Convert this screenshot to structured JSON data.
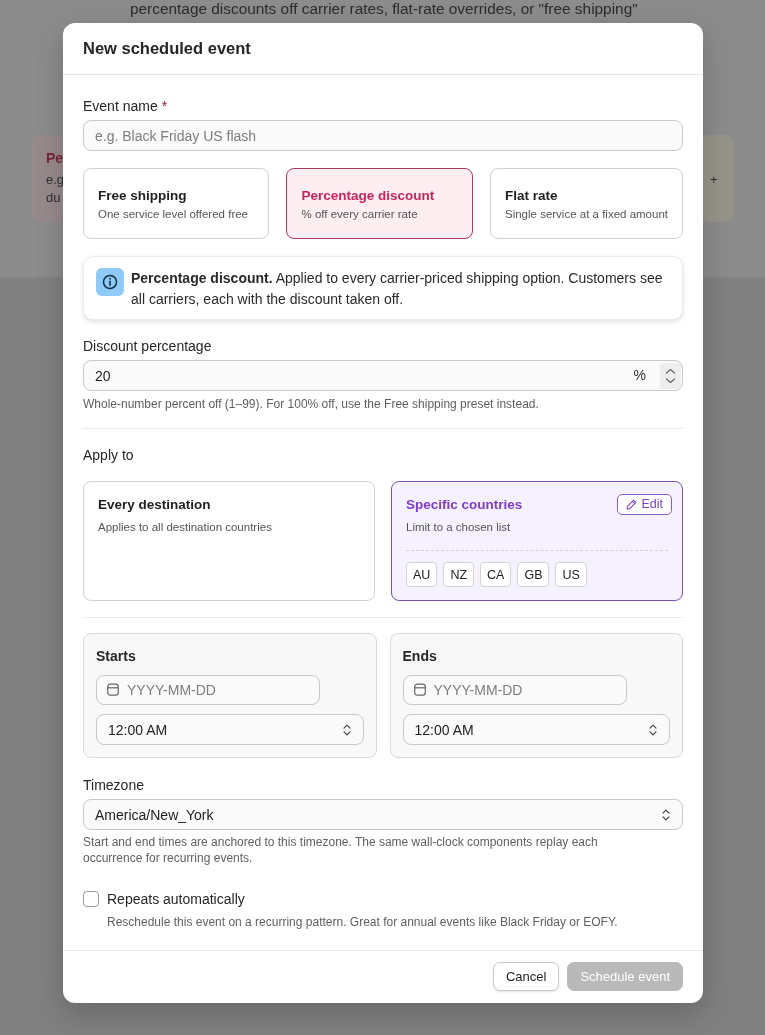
{
  "background": {
    "intro": "percentage discounts off carrier rates, flat-rate overrides, or \"free shipping\"",
    "cards": [
      {
        "title": "Pe",
        "lines": [
          "e.g",
          "du"
        ],
        "color": "#978a8d"
      },
      {
        "lines": [
          "+"
        ],
        "color": "#97958a"
      }
    ]
  },
  "dialog": {
    "title": "New scheduled event"
  },
  "event_name": {
    "label": "Event name",
    "required_mark": "*",
    "placeholder": "e.g. Black Friday US flash"
  },
  "presets": [
    {
      "title": "Free shipping",
      "description": "One service level offered free",
      "selected": false
    },
    {
      "title": "Percentage discount",
      "description": "% off every carrier rate",
      "selected": true
    },
    {
      "title": "Flat rate",
      "description": "Single service at a fixed amount",
      "selected": false
    }
  ],
  "callout": {
    "text": "**Percentage discount.** Applied to every carrier-priced shipping option. Customers see all carriers, each with the discount taken off."
  },
  "discount": {
    "label": "Discount percentage",
    "value": "20",
    "suffix": "%",
    "help": "Whole-number percent off (1–99). For 100% off, use the Free shipping preset instead."
  },
  "apply_to": {
    "label": "Apply to",
    "options": [
      {
        "title": "Every destination",
        "description": "Applies to all destination countries",
        "selected": false
      },
      {
        "title": "Specific countries",
        "description": "Limit to a chosen list",
        "selected": true,
        "edit_label": "Edit",
        "countries": [
          "AU",
          "NZ",
          "CA",
          "GB",
          "US"
        ]
      }
    ]
  },
  "schedule": [
    {
      "label": "Starts",
      "date_placeholder": "YYYY-MM-DD",
      "time": "12:00 AM"
    },
    {
      "label": "Ends",
      "date_placeholder": "YYYY-MM-DD",
      "time": "12:00 AM"
    }
  ],
  "timezone": {
    "label": "Timezone",
    "value": "America/New_York",
    "help": "Start and end times are anchored to this timezone. The same wall-clock components replay each occurrence for recurring events."
  },
  "repeat": {
    "label": "Repeats automatically",
    "checked": false,
    "description": "Reschedule this event on a recurring pattern. Great for annual events like Black Friday or EOFY."
  },
  "footer": {
    "buttons": [
      {
        "label": "Cancel",
        "kind": "secondary",
        "disabled": false
      },
      {
        "label": "Schedule event",
        "kind": "primary",
        "disabled": true
      }
    ]
  }
}
